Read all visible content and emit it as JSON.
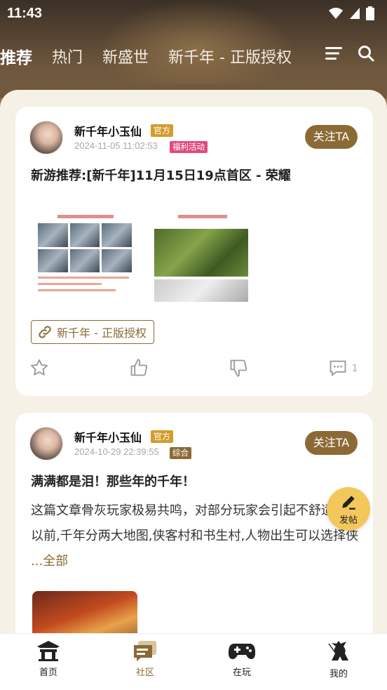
{
  "status_bar": {
    "time": "11:43"
  },
  "tabs": [
    {
      "label": "推荐",
      "active": true
    },
    {
      "label": "热门",
      "active": false
    },
    {
      "label": "新盛世",
      "active": false
    },
    {
      "label": "新千年 - 正版授权",
      "active": false
    }
  ],
  "posts": [
    {
      "author": "新千年小玉仙",
      "official_badge": "官方",
      "time": "2024-11-05 11:02:53",
      "category": "福利活动",
      "follow_label": "关注TA",
      "title": "新游推荐:[新千年]11月15日19点首区 - 荣耀",
      "link_tag": "新千年 - 正版授权",
      "comment_count": "1"
    },
    {
      "author": "新千年小玉仙",
      "official_badge": "官方",
      "time": "2024-10-29 22:39:55",
      "category": "综合",
      "follow_label": "关注TA",
      "title": "满满都是泪！那些年的千年！",
      "body": "  这篇文章骨灰玩家极易共鸣，对部分玩家会引起不舒适 ：   · 以前,千年分两大地图,侠客村和书生村,人物出生可以选择侠",
      "more_label": "...全部"
    }
  ],
  "fab": {
    "label": "发帖"
  },
  "bottom_nav": [
    {
      "label": "首页",
      "active": false
    },
    {
      "label": "社区",
      "active": true
    },
    {
      "label": "在玩",
      "active": false
    },
    {
      "label": "我的",
      "active": false
    }
  ],
  "colors": {
    "accent": "#8b6a35",
    "fab": "#f3c75a",
    "badge_official": "#d39c2b",
    "badge_welfare": "#e2497a"
  }
}
